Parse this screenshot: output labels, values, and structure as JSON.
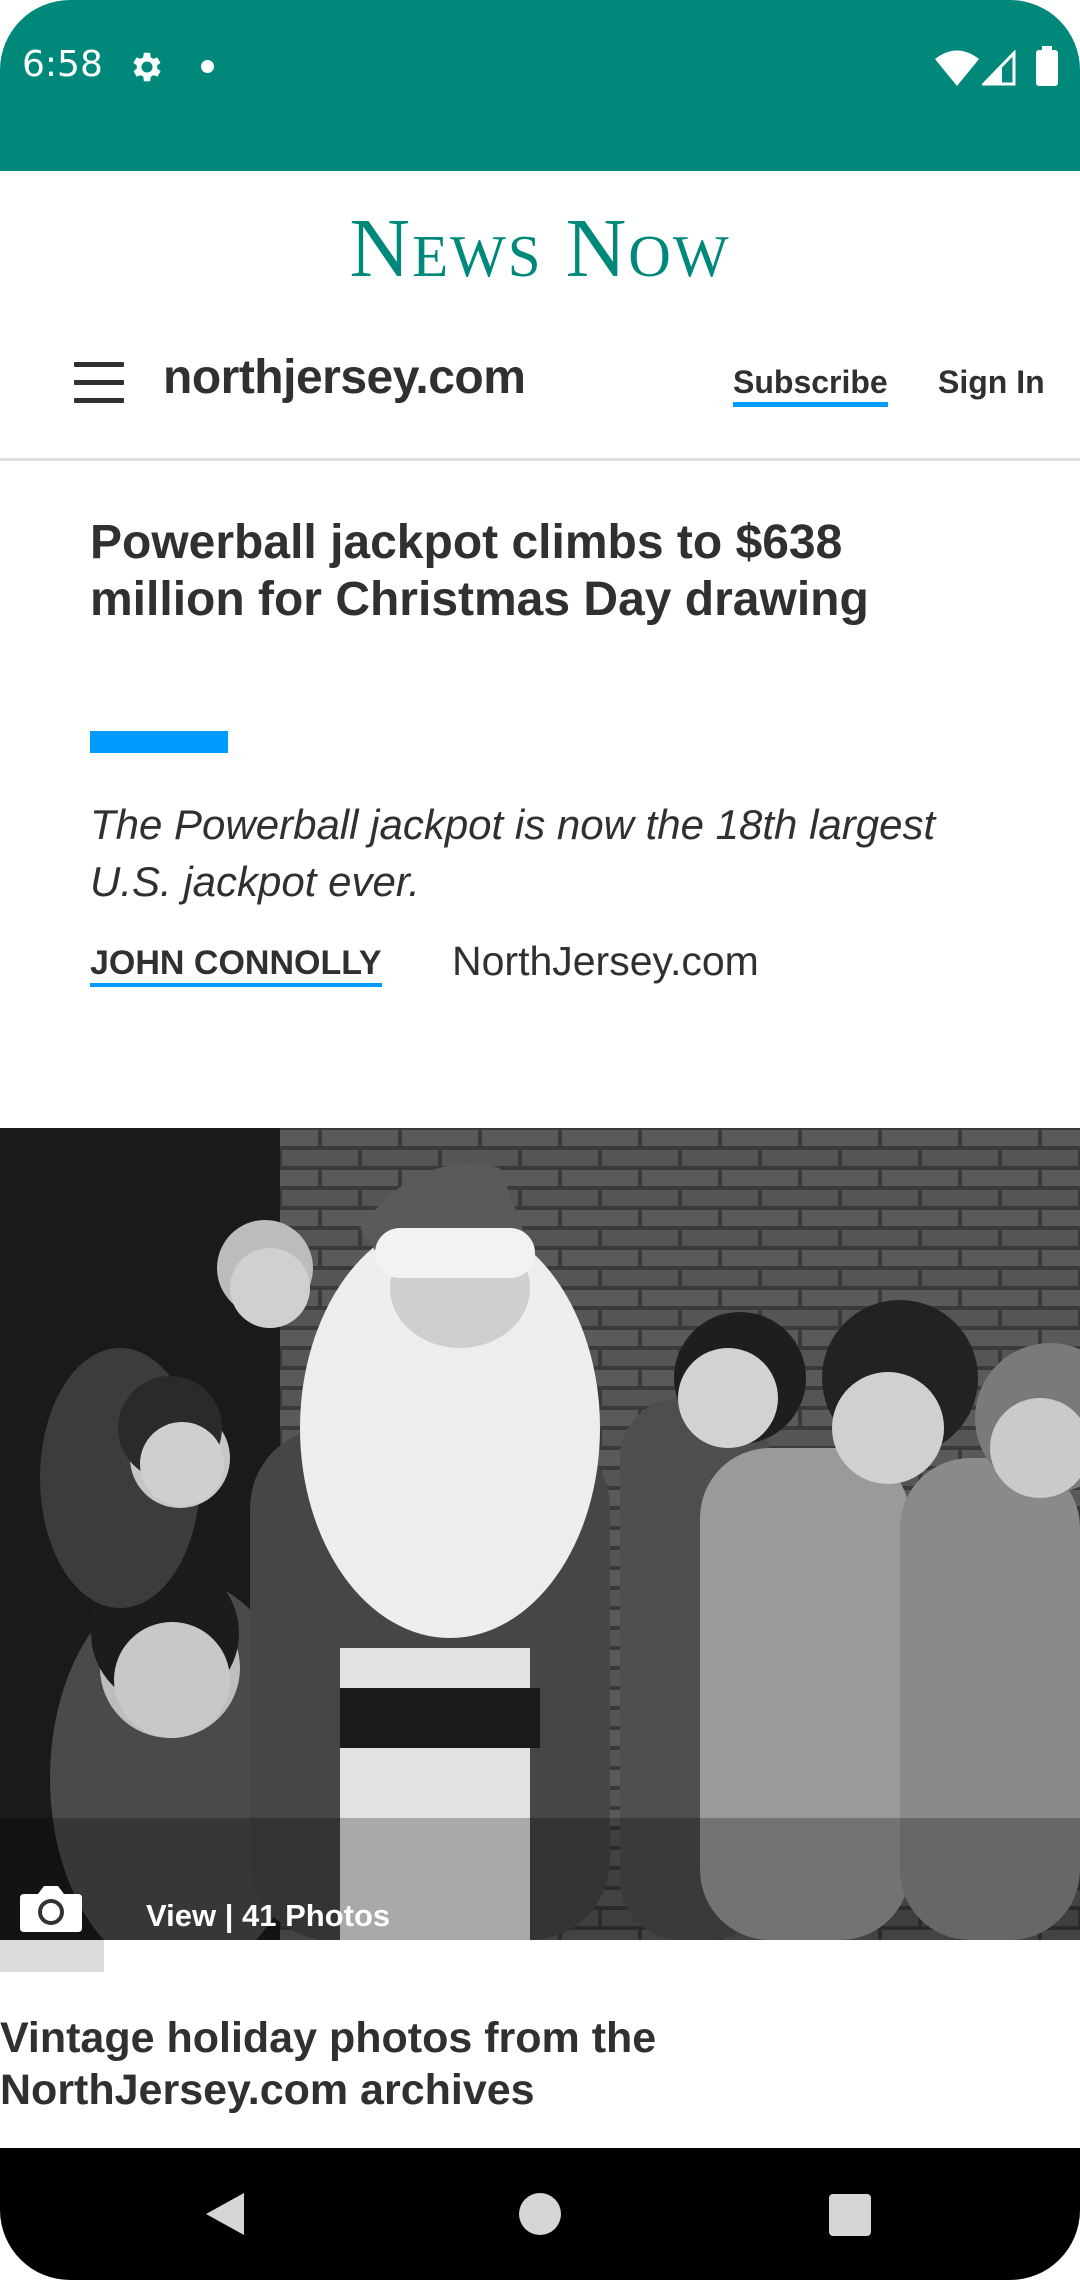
{
  "status_bar": {
    "time": "6:58",
    "icons": [
      "gear-icon",
      "notification-dot-icon",
      "wifi-icon",
      "cell-signal-icon",
      "battery-icon"
    ]
  },
  "app": {
    "title": "News Now",
    "accent_color": "#00897b"
  },
  "site_nav": {
    "logo": "northjersey.com",
    "subscribe_label": "Subscribe",
    "signin_label": "Sign In",
    "link_accent_color": "#009bff"
  },
  "article": {
    "title": "Powerball jackpot climbs to $638 million for Christmas Day drawing",
    "summary": "The Powerball jackpot is now the 18th largest U.S. jackpot ever.",
    "author": "JOHN CONNOLLY",
    "source": "NorthJersey.com"
  },
  "gallery": {
    "view_label": "View | 41 Photos",
    "caption": "Vintage holiday photos from the NorthJersey.com archives",
    "photo_subject": "Black-and-white photo of Santa Claus surrounded by smiling children"
  },
  "nav_bar": {
    "buttons": [
      "back-icon",
      "home-icon",
      "recents-icon"
    ]
  }
}
